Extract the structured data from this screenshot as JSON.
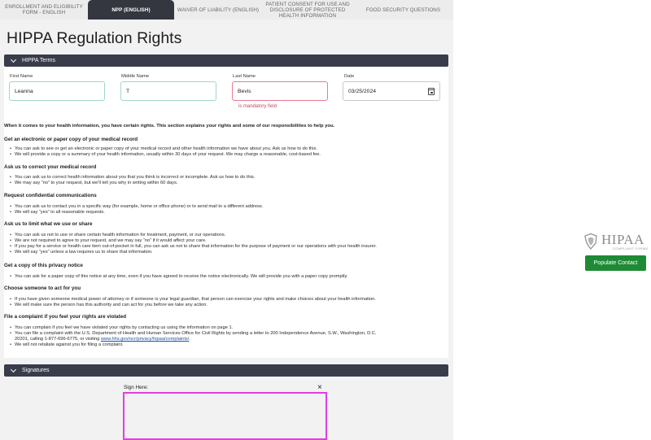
{
  "tabs": [
    {
      "label": "ENROLLMENT AND ELIGIBILITY FORM - ENGLISH",
      "active": false
    },
    {
      "label": "NPP (ENGLISH)",
      "active": true
    },
    {
      "label": "WAIVER OF LIABILITY (ENGLISH)",
      "active": false
    },
    {
      "label": "PATIENT CONSENT FOR USE AND DISCLOSURE OF PROTECTED HEALTH INFORMATION",
      "active": false
    },
    {
      "label": "FOOD SECURITY QUESTIONS",
      "active": false
    }
  ],
  "page_title": "HIPPA Regulation Rights",
  "terms_section": {
    "title": "HIPPA Terms"
  },
  "fields": {
    "first_name": {
      "label": "First Name",
      "value": "Leanna"
    },
    "middle_name": {
      "label": "Middle Name",
      "value": "T"
    },
    "last_name": {
      "label": "Last Name",
      "value": "Bevis",
      "error": "is mandatory field"
    },
    "date": {
      "label": "Date",
      "value": "03/25/2024"
    }
  },
  "intro": "When it comes to your health information, you have certain rights. This section explains your rights and some of our responsibilities to help you.",
  "sections": [
    {
      "heading": "Get an electronic or paper copy of your medical record",
      "bullets": [
        "You can ask to see or get an electronic or paper copy of your medical record and other health information we have about you. Ask us how to do this.",
        "We will provide a copy or a summary of your health information, usually within 30 days of your request. We may charge a reasonable, cost-based fee."
      ]
    },
    {
      "heading": "Ask us to correct your medical record",
      "bullets": [
        "You can ask us to correct health information about you that you think is incorrect or incomplete. Ask us how to do this.",
        "We may say “no” to your request, but we'll tell you why in writing within 60 days."
      ]
    },
    {
      "heading": "Request confidential communications",
      "bullets": [
        "You can ask us to contact you in a specific way (for example, home or office phone) or to send mail to a different address.",
        "We will say “yes” to all reasonable requests."
      ]
    },
    {
      "heading": "Ask us to limit what we use or share",
      "bullets": [
        "You can ask us not to use or share certain health information for treatment, payment, or our operations.",
        "We are not required to agree to your request, and we may say “no” if it would affect your care.",
        "If you pay for a service or health care item out-of-pocket in full, you can ask us not to share that information for the purpose of payment or our operations with your health insurer.",
        "We will say “yes” unless a law requires us to share that information."
      ]
    },
    {
      "heading": "Get a copy of this privacy notice",
      "bullets": [
        "You can ask for a paper copy of this notice at any time, even if you have agreed to receive the notice electronically. We will provide you with a paper copy promptly."
      ]
    },
    {
      "heading": "Choose someone to act for you",
      "bullets": [
        "If you have given someone medical power of attorney or if someone is your legal guardian, that person can exercise your rights and make choices about your health information.",
        "We will make sure the person has this authority and can act for you before we take any action."
      ]
    },
    {
      "heading": "File a complaint if you feel your rights are violated",
      "bullets": [
        "You can complain if you feel we have violated your rights by contacting us using the information on page 1.",
        "You can file a complaint with the U.S. Department of Health and Human Services Office for Civil Rights by sending a letter to 200 Independence Avenue, S.W., Washington, D.C.",
        "20201, calling 1-877-696-6775, or visiting ",
        "We will not retaliate against you for filing a complaint."
      ],
      "link": "www.hhs.gov/ocr/privacy/hipaa/complaints/"
    }
  ],
  "signatures_section": {
    "title": "Signatures",
    "sign_label": "Sign Here:",
    "close_symbol": "×"
  },
  "logo": {
    "text": "HIPAA",
    "sub": "COMPLIANT FORMS"
  },
  "populate_button": "Populate Contact",
  "colors": {
    "section_bar": "#383c4b",
    "active_tab": "#34373f",
    "populate_button": "#1f8a35",
    "signature_border": "#e23ee0",
    "error": "#c04a5f"
  }
}
